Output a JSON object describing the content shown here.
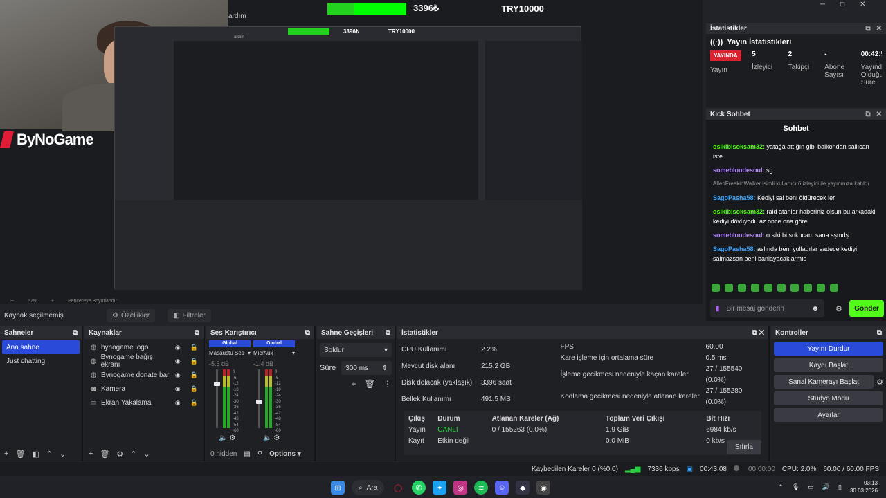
{
  "donation": {
    "amount": "3396₺",
    "goal": "TRY10000",
    "progress_fraction": 0.34
  },
  "menu_partial": "ardım",
  "brand": "ByNoGame",
  "nested_preview": {
    "amount": "3396₺",
    "goal": "TRY10000",
    "menu_partial": "ardım"
  },
  "window_controls": [
    "─",
    "□",
    "✕"
  ],
  "stats_panel": {
    "header": "İstatistikler",
    "subtitle": "Yayın İstatistikleri",
    "live_badge": "YAYINDA",
    "items": [
      {
        "value": "",
        "label": "Yayın"
      },
      {
        "value": "5",
        "label": "İzleyici"
      },
      {
        "value": "2",
        "label": "Takipçi"
      },
      {
        "value": "-",
        "label": "Abone Sayısı"
      },
      {
        "value": "00:42:5",
        "label": "Yayında Olduğu Süre"
      }
    ]
  },
  "chat_panel": {
    "header": "Kick Sohbet",
    "title": "Sohbet",
    "messages": [
      {
        "user": "osikibisoksam32:",
        "text": " yatağa attığın gibi balkondan sallıcan iste",
        "color": "green"
      },
      {
        "user": "someblondesoul:",
        "text": " sg",
        "color": "purple"
      },
      {
        "note": "AllenFreakinWalker isimli kullanıcı 6 izleyici ile yayınınıza katıldı"
      },
      {
        "user": "SagoPasha58:",
        "text": " Kediyi sal beni öldürecek ler",
        "color": "blue"
      },
      {
        "user": "osikibisoksam32:",
        "text": " raid atanlar haberiniz olsun bu arkadaki kediyi dövüyodu az once ona göre",
        "color": "green"
      },
      {
        "user": "someblondesoul:",
        "text": " o siki bi sokucam sana sşmdş",
        "color": "purple"
      },
      {
        "user": "SagoPasha58:",
        "text": " aslında beni yolladılar sadece kediyi salmazsan beni banlayacaklarmıs",
        "color": "blue"
      }
    ],
    "input_placeholder": "Bir mesaj gönderin",
    "send_label": "Gönder"
  },
  "zoom": {
    "level": "52%",
    "fit": "Pencereye Boyutlandır"
  },
  "source_bar": {
    "selected": "Kaynak seçilmemiş",
    "props": "Özellikler",
    "filters": "Filtreler"
  },
  "scenes": {
    "title": "Sahneler",
    "items": [
      "Ana sahne",
      "Just chatting"
    ]
  },
  "sources": {
    "title": "Kaynaklar",
    "items": [
      {
        "icon": "globe-icon",
        "name": "bynogame logo"
      },
      {
        "icon": "globe-icon",
        "name": "Bynogame bağış ekranı"
      },
      {
        "icon": "globe-icon",
        "name": "Bynogame donate bar"
      },
      {
        "icon": "camera-icon",
        "name": "Kamera"
      },
      {
        "icon": "monitor-icon",
        "name": "Ekran Yakalama"
      }
    ]
  },
  "mixer": {
    "title": "Ses Karıştırıcı",
    "channels": [
      {
        "badge": "Global",
        "name": "Masaüstü Ses",
        "db": "-5.5 dB",
        "level": 0.25
      },
      {
        "badge": "Global",
        "name": "Mic/Aux",
        "db": "-1.4 dB",
        "level": 0.55
      }
    ],
    "ticks": [
      "0",
      "-6",
      "-12",
      "-18",
      "-24",
      "-30",
      "-36",
      "-42",
      "-48",
      "-54",
      "-60"
    ],
    "hidden": "0 hidden",
    "options": "Options"
  },
  "transitions": {
    "title": "Sahne Geçişleri",
    "type": "Soldur",
    "duration_label": "Süre",
    "duration": "300 ms"
  },
  "stats": {
    "title": "İstatistikler",
    "left": [
      {
        "k": "CPU Kullanımı",
        "v": "2.2%"
      },
      {
        "k": "Mevcut disk alanı",
        "v": "215.2 GB"
      },
      {
        "k": "Disk dolacak (yaklaşık)",
        "v": "3396 saat"
      },
      {
        "k": "Bellek Kullanımı",
        "v": "491.5 MB"
      }
    ],
    "right": [
      {
        "k": "FPS",
        "v": "60.00"
      },
      {
        "k": "Kare işleme için ortalama süre",
        "v": "0.5 ms"
      },
      {
        "k": "İşleme gecikmesi nedeniyle kaçan kareler",
        "v": "27 / 155540 (0.0%)"
      },
      {
        "k": "Kodlama gecikmesi nedeniyle atlanan kareler",
        "v": "27 / 155280 (0.0%)"
      }
    ],
    "table_head": [
      "Çıkış",
      "Durum",
      "Atlanan Kareler (Ağ)",
      "Toplam Veri Çıkışı",
      "Bit Hızı"
    ],
    "rows": [
      [
        "Yayın",
        "CANLI",
        "0 / 155263 (0.0%)",
        "1.9 GiB",
        "6984 kb/s"
      ],
      [
        "Kayıt",
        "Etkin değil",
        "",
        "0.0 MiB",
        "0 kb/s"
      ]
    ],
    "reset": "Sıfırla"
  },
  "controls": {
    "title": "Kontroller",
    "buttons": [
      "Yayını Durdur",
      "Kaydı Başlat",
      "Sanal Kamerayı Başlat",
      "Stüdyo Modu",
      "Ayarlar"
    ]
  },
  "statusbar": {
    "dropped": "Kaybedilen Kareler 0 (%0.0)",
    "bitrate": "7336 kbps",
    "live_time": "00:43:08",
    "rec_time": "00:00:00",
    "cpu": "CPU: 2.0%",
    "fps": "60.00 / 60.00 FPS"
  },
  "taskbar": {
    "search": "Ara",
    "time": "03:13",
    "date": "30.03.2026"
  },
  "colors": {
    "accent": "#2a4bd7",
    "kick_green": "#53fc18",
    "live_red": "#d9232e"
  }
}
